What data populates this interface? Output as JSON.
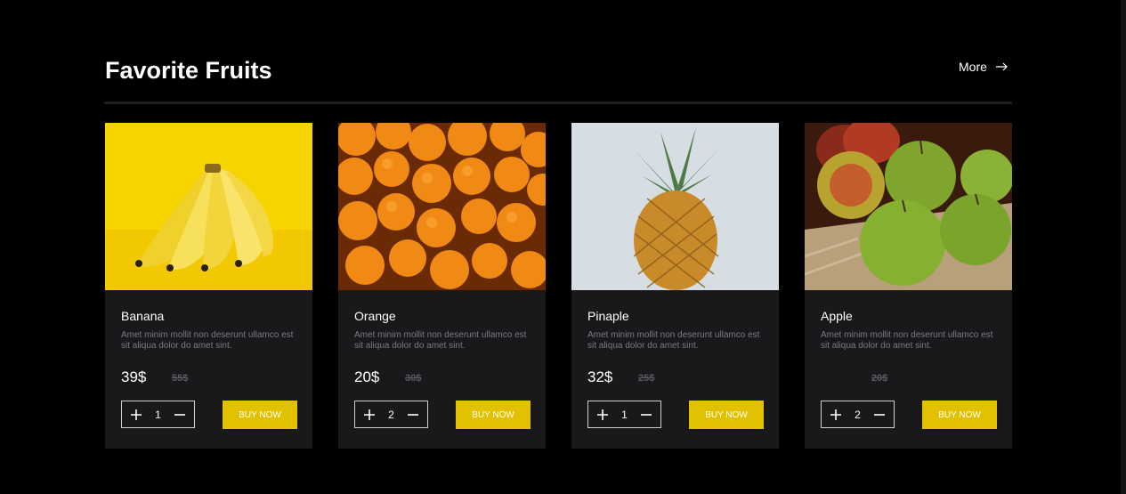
{
  "section": {
    "title": "Favorite Fruits",
    "more_label": "More"
  },
  "products": [
    {
      "name": "Banana",
      "description": "Amet minim mollit non deserunt ullamco est sit aliqua dolor do amet sint.",
      "price": "39$",
      "old_price": "55$",
      "quantity": "1",
      "buy_label": "BUY NOW"
    },
    {
      "name": "Orange",
      "description": "Amet minim mollit non deserunt ullamco est sit aliqua dolor do amet sint.",
      "price": "20$",
      "old_price": "30$",
      "quantity": "2",
      "buy_label": "BUY NOW"
    },
    {
      "name": "Pinaple",
      "description": "Amet minim mollit non deserunt ullamco est sit aliqua dolor do amet sint.",
      "price": "32$",
      "old_price": "25$",
      "quantity": "1",
      "buy_label": "BUY NOW"
    },
    {
      "name": "Apple",
      "description": "Amet minim mollit non deserunt ullamco est sit aliqua dolor do amet sint.",
      "price": "",
      "old_price": "20$",
      "quantity": "2",
      "buy_label": "BUY NOW"
    }
  ],
  "colors": {
    "background": "#000000",
    "card": "#19191b",
    "accent": "#e2c200"
  },
  "icons": {
    "more": "arrow-right-icon",
    "increment": "plus-icon",
    "decrement": "minus-icon"
  }
}
